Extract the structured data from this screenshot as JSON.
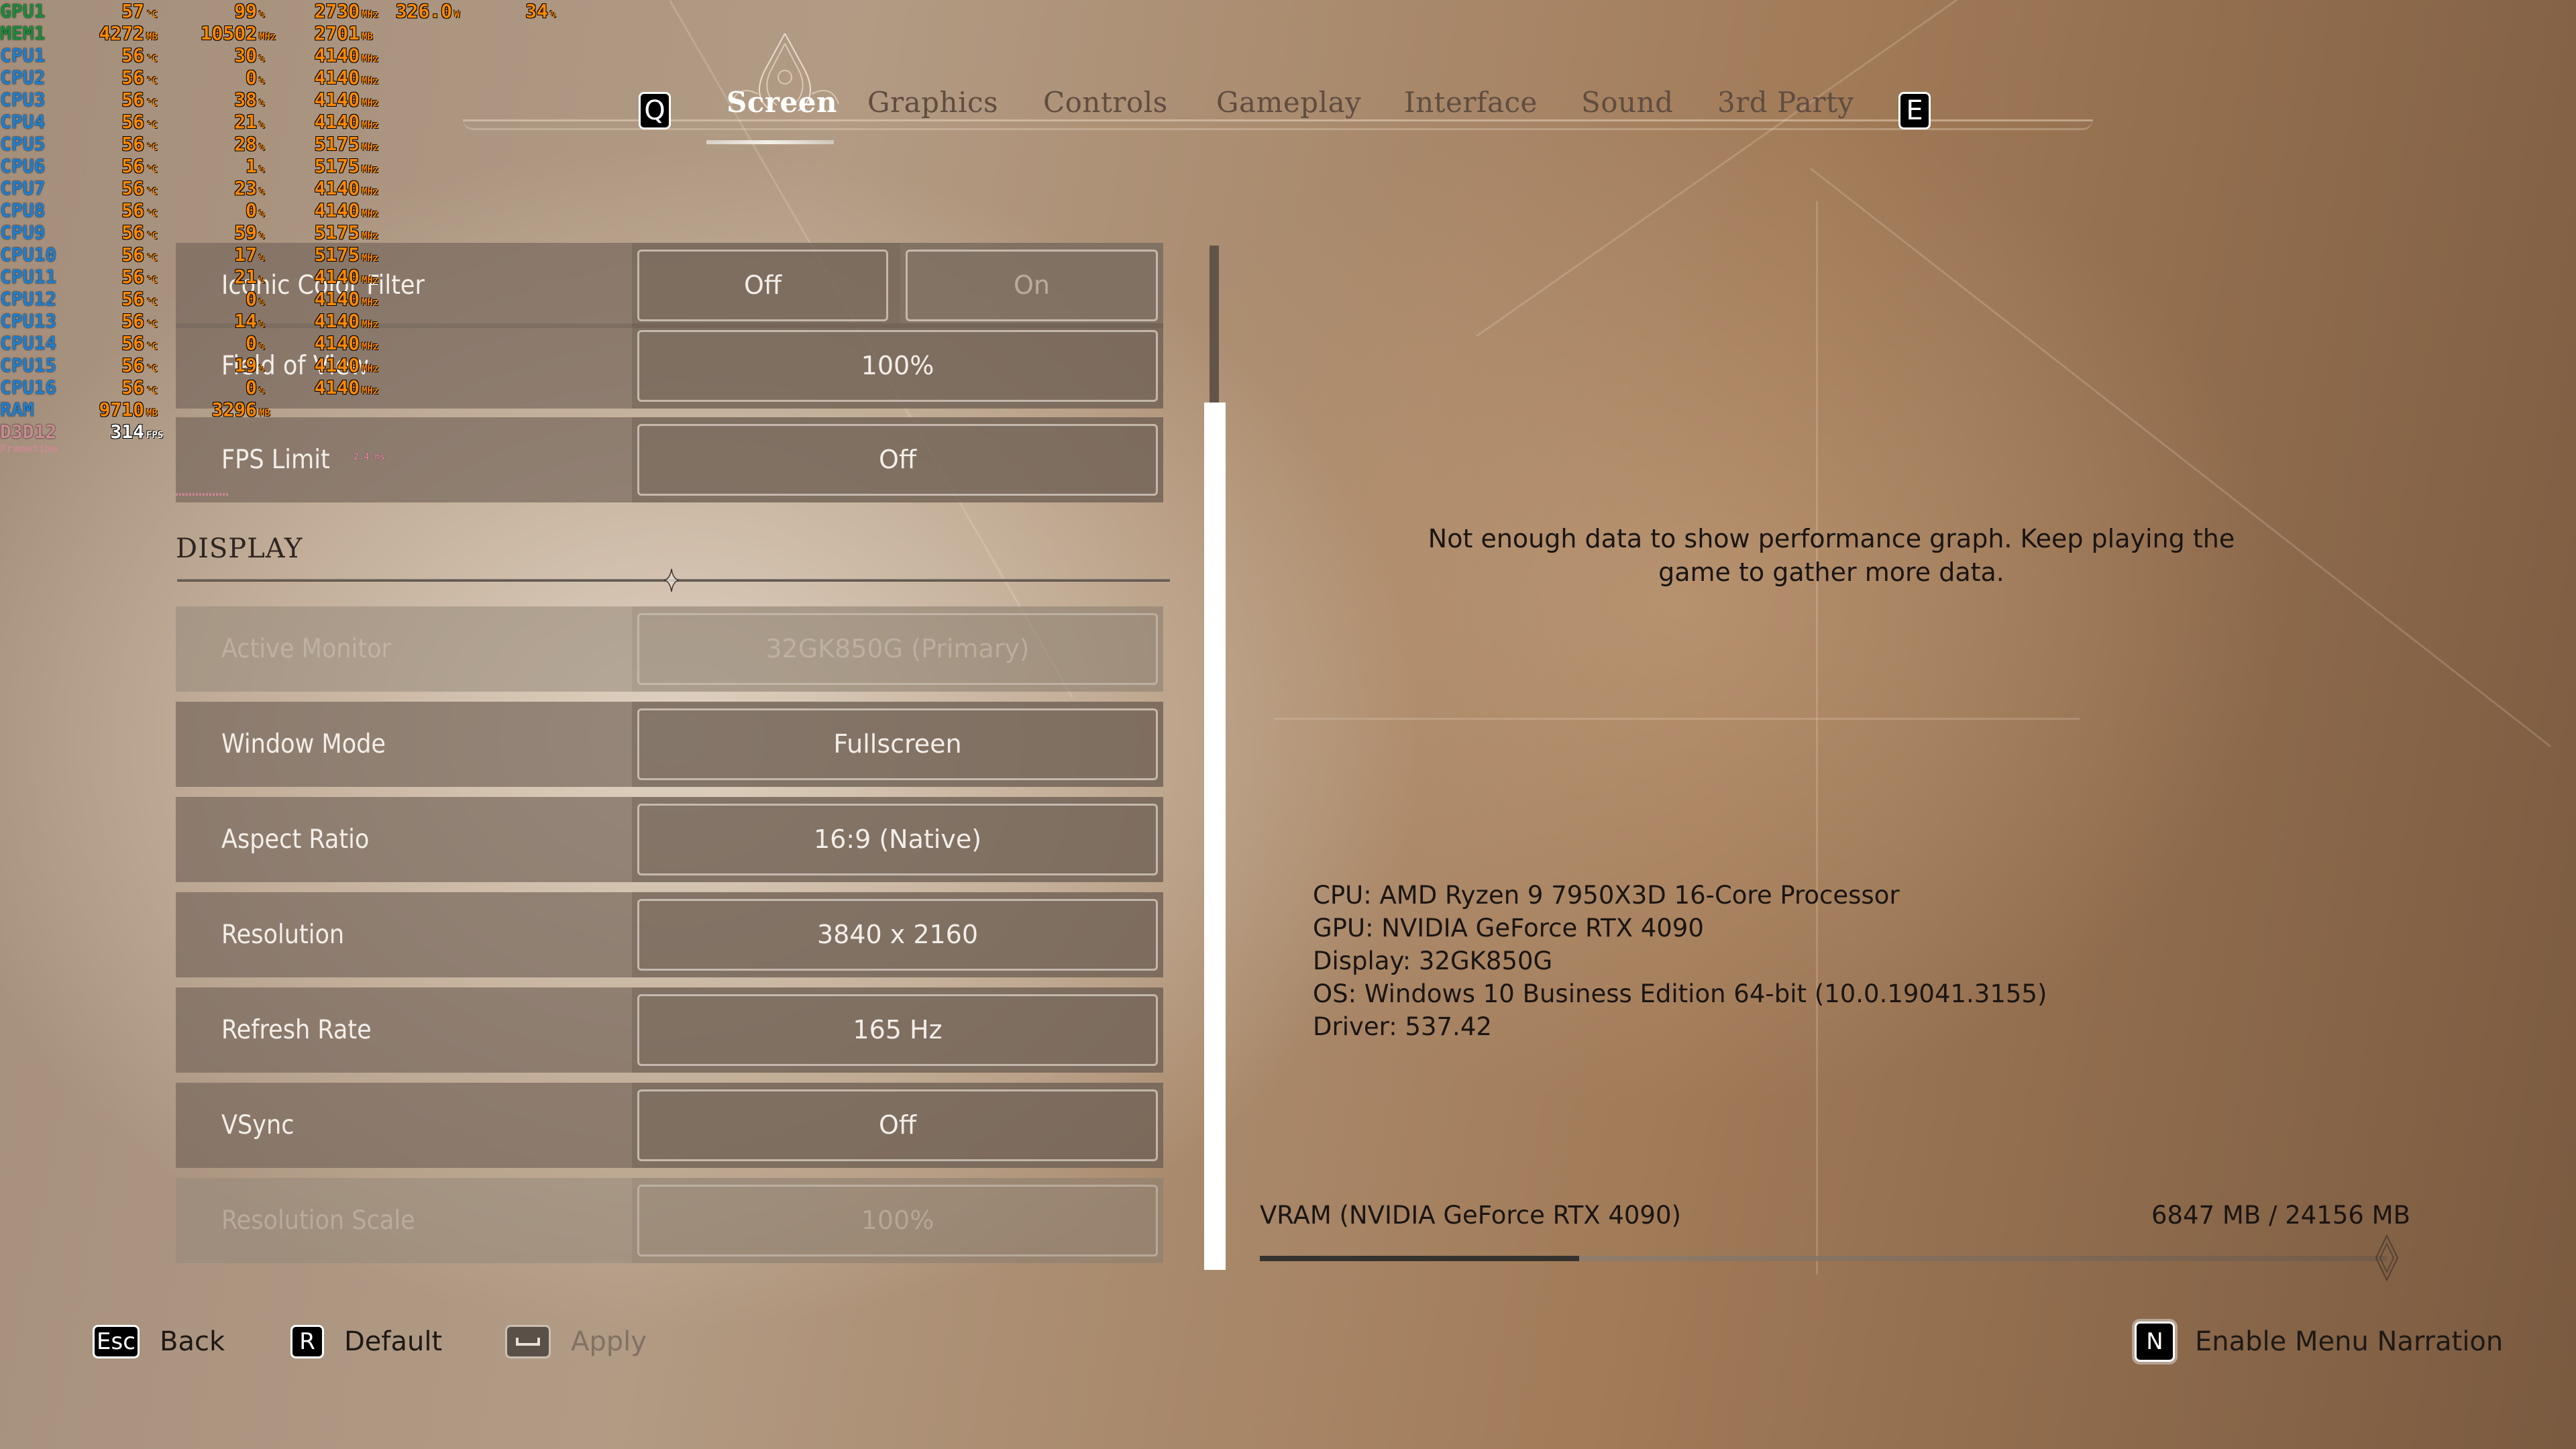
{
  "osd": {
    "gpu": {
      "label": "GPU1",
      "temp": "57",
      "temp_unit": "°C",
      "load": "99",
      "load_unit": "%",
      "clock": "2730",
      "clock_unit": "MHz",
      "power": "326.0",
      "power_unit": "W",
      "fan": "34",
      "fan_unit": "%"
    },
    "mem": {
      "label": "MEM1",
      "used": "4272",
      "used_unit": "MB",
      "clock": "10502",
      "clock_unit": "MHz",
      "dedicated": "2701",
      "dedicated_unit": "MB"
    },
    "cpus": [
      {
        "label": "CPU1",
        "temp": "56",
        "load": "30",
        "clock": "4140"
      },
      {
        "label": "CPU2",
        "temp": "56",
        "load": "0",
        "clock": "4140"
      },
      {
        "label": "CPU3",
        "temp": "56",
        "load": "38",
        "clock": "4140"
      },
      {
        "label": "CPU4",
        "temp": "56",
        "load": "21",
        "clock": "4140"
      },
      {
        "label": "CPU5",
        "temp": "56",
        "load": "28",
        "clock": "5175"
      },
      {
        "label": "CPU6",
        "temp": "56",
        "load": "1",
        "clock": "5175"
      },
      {
        "label": "CPU7",
        "temp": "56",
        "load": "23",
        "clock": "4140"
      },
      {
        "label": "CPU8",
        "temp": "56",
        "load": "0",
        "clock": "4140"
      },
      {
        "label": "CPU9",
        "temp": "56",
        "load": "59",
        "clock": "5175"
      },
      {
        "label": "CPU10",
        "temp": "56",
        "load": "17",
        "clock": "5175"
      },
      {
        "label": "CPU11",
        "temp": "56",
        "load": "21",
        "clock": "4140"
      },
      {
        "label": "CPU12",
        "temp": "56",
        "load": "0",
        "clock": "4140"
      },
      {
        "label": "CPU13",
        "temp": "56",
        "load": "14",
        "clock": "4140"
      },
      {
        "label": "CPU14",
        "temp": "56",
        "load": "0",
        "clock": "4140"
      },
      {
        "label": "CPU15",
        "temp": "56",
        "load": "19",
        "clock": "4140"
      },
      {
        "label": "CPU16",
        "temp": "56",
        "load": "0",
        "clock": "4140"
      }
    ],
    "cpu_temp_unit": "°C",
    "cpu_load_unit": "%",
    "cpu_clock_unit": "MHz",
    "ram": {
      "label": "RAM",
      "used": "9710",
      "used_unit": "MB",
      "other": "3296",
      "other_unit": "MB"
    },
    "d3d": {
      "label": "D3D12",
      "fps": "314",
      "fps_unit": "FPS",
      "frametime_label": "Frametime",
      "frametime": "2.4 ms"
    }
  },
  "tabs": {
    "prev_key": "Q",
    "next_key": "E",
    "items": [
      {
        "label": "Screen",
        "active": true
      },
      {
        "label": "Graphics"
      },
      {
        "label": "Controls"
      },
      {
        "label": "Gameplay"
      },
      {
        "label": "Interface"
      },
      {
        "label": "Sound"
      },
      {
        "label": "3rd Party"
      }
    ]
  },
  "settings": {
    "iconic_color_filter": {
      "label": "Iconic Color Filter",
      "options": [
        "Off",
        "On"
      ],
      "selected": "Off"
    },
    "field_of_view": {
      "label": "Field of View",
      "value": "100%"
    },
    "fps_limit": {
      "label": "FPS Limit",
      "value": "Off"
    },
    "display_section": "DISPLAY",
    "active_monitor": {
      "label": "Active Monitor",
      "value": "32GK850G (Primary)",
      "disabled": true
    },
    "window_mode": {
      "label": "Window Mode",
      "value": "Fullscreen"
    },
    "aspect_ratio": {
      "label": "Aspect Ratio",
      "value": "16:9 (Native)"
    },
    "resolution": {
      "label": "Resolution",
      "value": "3840 x 2160"
    },
    "refresh_rate": {
      "label": "Refresh Rate",
      "value": "165 Hz"
    },
    "vsync": {
      "label": "VSync",
      "value": "Off"
    },
    "resolution_scale": {
      "label": "Resolution Scale",
      "value": "100%",
      "disabled": true
    }
  },
  "scrollbar": {
    "position_fraction": 0.15,
    "visible_fraction": 0.85
  },
  "right_panel": {
    "perf_message_line1": "Not enough data to show performance graph. Keep playing the",
    "perf_message_line2": "game to gather more data.",
    "sysinfo": [
      "CPU: AMD Ryzen 9 7950X3D 16-Core Processor",
      "GPU: NVIDIA GeForce RTX 4090",
      "Display: 32GK850G",
      "OS: Windows 10 Business Edition 64-bit (10.0.19041.3155)",
      "Driver: 537.42"
    ],
    "vram": {
      "label": "VRAM (NVIDIA GeForce RTX 4090)",
      "used_mb": 6847,
      "total_mb": 24156,
      "text": "6847 MB / 24156 MB"
    }
  },
  "footer": {
    "back": {
      "key": "Esc",
      "label": "Back"
    },
    "default": {
      "key": "R",
      "label": "Default"
    },
    "apply": {
      "key": "␣",
      "label": "Apply",
      "disabled": true
    },
    "narration": {
      "key": "N",
      "label": "Enable Menu Narration"
    }
  }
}
